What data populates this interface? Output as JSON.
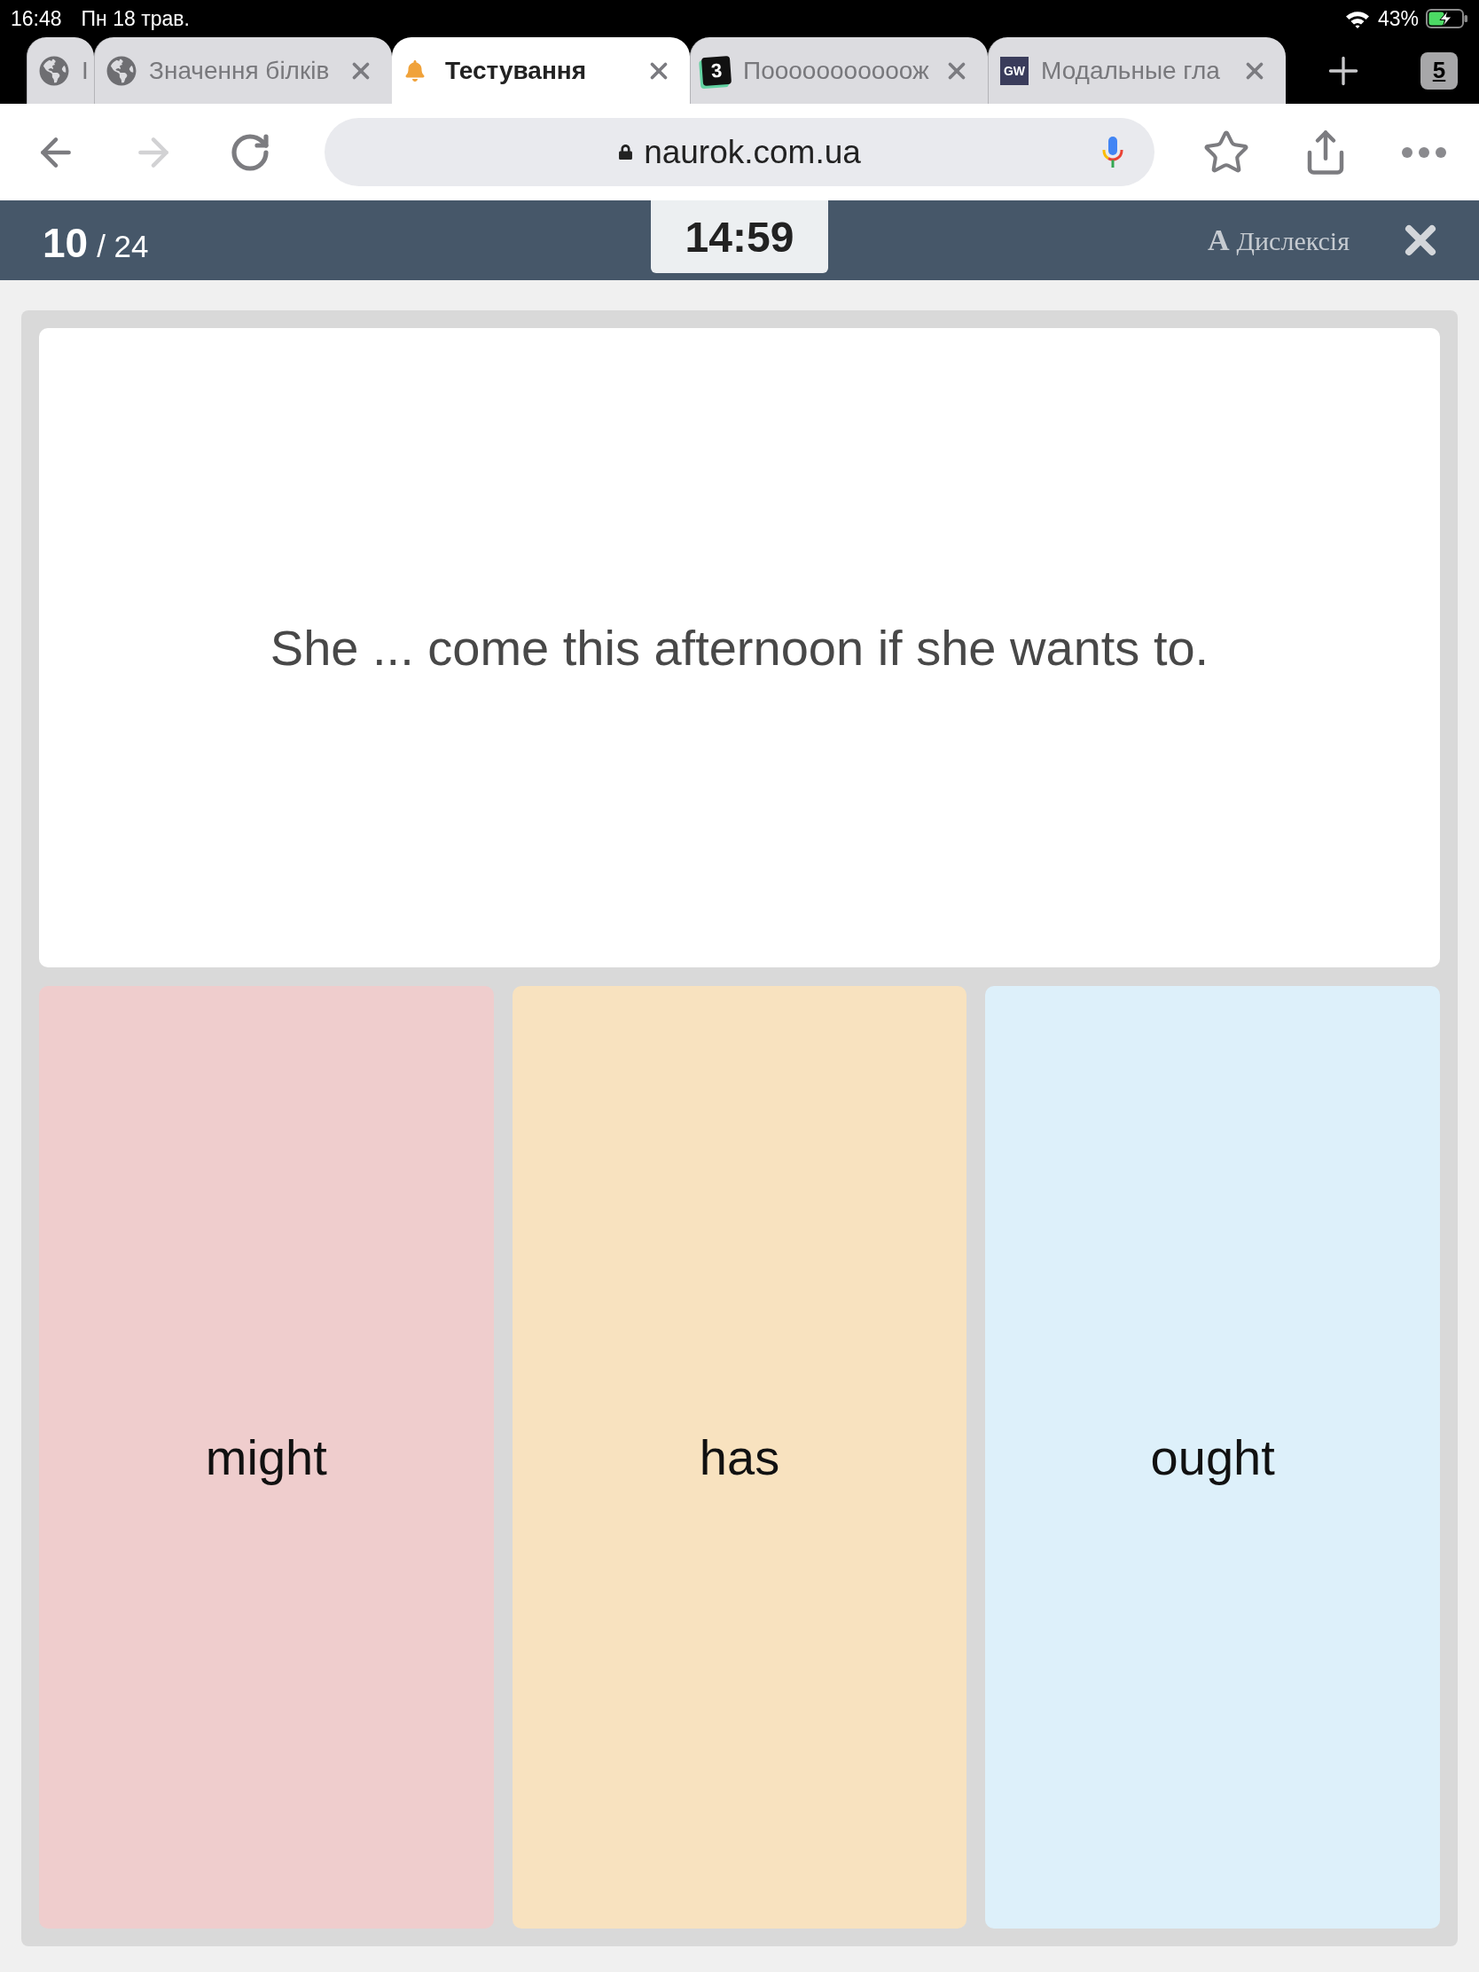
{
  "status_bar": {
    "time": "16:48",
    "date": "Пн 18 трав.",
    "battery": "43%"
  },
  "browser_tabs": [
    {
      "title": "I",
      "favicon": {
        "kind": "globe"
      },
      "collapsed": true,
      "selected": false
    },
    {
      "title": "Значення білків",
      "favicon": {
        "kind": "globe"
      },
      "collapsed": false,
      "selected": false
    },
    {
      "title": "Тестування",
      "favicon": {
        "kind": "bell"
      },
      "collapsed": false,
      "selected": true
    },
    {
      "title": "Пооооооооооож",
      "favicon": {
        "kind": "dark-tile",
        "text": "3"
      },
      "collapsed": false,
      "selected": false
    },
    {
      "title": "Модальные гла",
      "favicon": {
        "kind": "navy-tile",
        "text": "GW"
      },
      "collapsed": false,
      "selected": false
    }
  ],
  "tab_count": "5",
  "navigation": [
    {
      "kind": "back",
      "disabled": false
    },
    {
      "kind": "forward",
      "disabled": true
    },
    {
      "kind": "reload",
      "disabled": false
    }
  ],
  "address_bar": {
    "url": "naurok.com.ua"
  },
  "quiz_header": {
    "current": "10",
    "total": "/ 24",
    "timer": "14:59",
    "dyslexia_glyph": "A",
    "dyslexia_label": "Дислексія"
  },
  "question": "She ... come this afternoon if she wants to.",
  "answers": [
    {
      "text": "might",
      "color": "#efcdcd"
    },
    {
      "text": "has",
      "color": "#f8e2bf"
    },
    {
      "text": "ought",
      "color": "#ddf0fa"
    }
  ]
}
